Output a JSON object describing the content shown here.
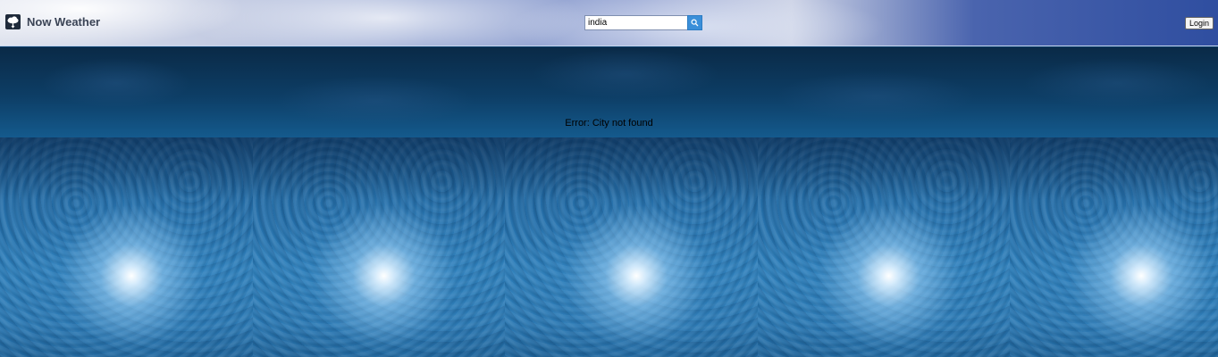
{
  "header": {
    "brand": "Now Weather",
    "logo_icon": "weather-cloud-icon",
    "search": {
      "value": "india",
      "button_icon": "search-icon"
    },
    "login_label": "Login"
  },
  "main": {
    "error_text": "Error: City not found"
  },
  "colors": {
    "search_button": "#3a8fd9",
    "sky_dark": "#0a2a47",
    "ice_blue": "#2570ab"
  }
}
